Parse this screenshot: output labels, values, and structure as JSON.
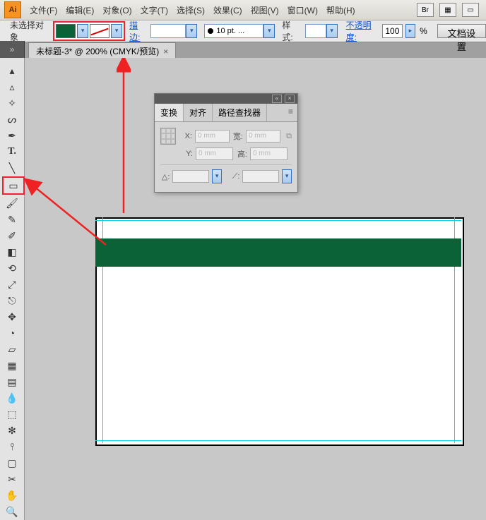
{
  "app": {
    "logo": "Ai"
  },
  "menu": {
    "items": [
      "文件(F)",
      "编辑(E)",
      "对象(O)",
      "文字(T)",
      "选择(S)",
      "效果(C)",
      "视图(V)",
      "窗口(W)",
      "帮助(H)"
    ]
  },
  "options": {
    "no_select": "未选择对象",
    "stroke_label": "描边:",
    "stroke_weight": "10 pt. ...",
    "style_label": "样式:",
    "opacity_label": "不透明度:",
    "opacity_value": "100",
    "opacity_pct": "%",
    "doc_setup": "文档设置",
    "fill_color": "#0b6237"
  },
  "tab": {
    "title": "未标题-3* @ 200% (CMYK/预览)",
    "close": "×"
  },
  "panel": {
    "tabs": [
      "变换",
      "对齐",
      "路径查找器"
    ],
    "labels": {
      "x": "X:",
      "y": "Y:",
      "w": "宽:",
      "h": "高:",
      "angle": "△:",
      "shear": "⟋:"
    },
    "placeholder": "0 mm"
  },
  "tools": [
    "selection",
    "direct-select",
    "magic-wand",
    "lasso",
    "pen",
    "type",
    "line",
    "rectangle",
    "paintbrush",
    "pencil",
    "blob-brush",
    "eraser",
    "rotate",
    "scale",
    "width",
    "free-transform",
    "shape-builder",
    "perspective",
    "mesh",
    "gradient",
    "eyedropper",
    "blend",
    "symbol-sprayer",
    "column-graph",
    "artboard",
    "slice",
    "hand",
    "zoom",
    "fill-stroke"
  ]
}
